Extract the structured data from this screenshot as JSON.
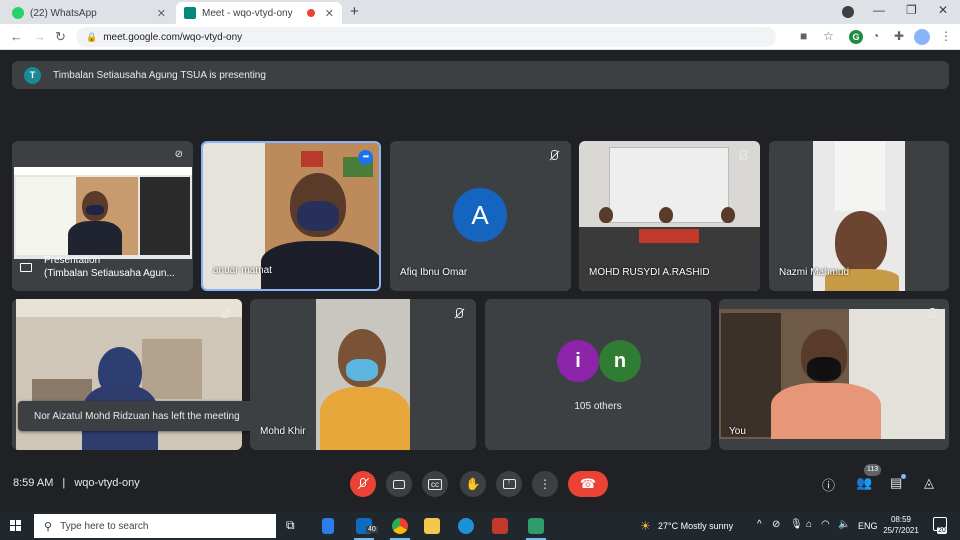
{
  "browser": {
    "tabs": [
      {
        "title": "(22) WhatsApp",
        "favicon": "whatsapp-icon",
        "color": "#25d366"
      },
      {
        "title": "Meet - wqo-vtyd-ony",
        "favicon": "meet-icon",
        "color": "#00897b"
      }
    ],
    "url": "meet.google.com/wqo-vtyd-ony"
  },
  "meeting": {
    "presenting_banner": "Timbalan Setiausaha Agung TSUA is presenting",
    "presenter_initial": "T",
    "tiles": [
      {
        "name_line1": "Presentation",
        "name_line2": "(Timbalan Setiausaha Agun..."
      },
      {
        "name": "anuar mamat"
      },
      {
        "name": "Afiq Ibnu Omar",
        "initial": "A"
      },
      {
        "name": "MOHD RUSYDI A.RASHID"
      },
      {
        "name": "Nazmi Mahmud"
      },
      {
        "name": ""
      },
      {
        "name": "Mohd Khir"
      },
      {
        "name": "105 others",
        "initials": [
          "i",
          "n"
        ]
      },
      {
        "name": "You"
      }
    ],
    "toast": "Nor Aizatul Mohd Ridzuan has left the meeting",
    "time": "8:59 AM",
    "separator": "|",
    "code": "wqo-vtyd-ony",
    "participants_count": "113"
  },
  "taskbar": {
    "search_placeholder": "Type here to search",
    "mail_badge": "40",
    "weather": "27°C  Mostly sunny",
    "lang": "ENG",
    "time": "08:59",
    "date": "25/7/2021",
    "notification_count": "20"
  }
}
